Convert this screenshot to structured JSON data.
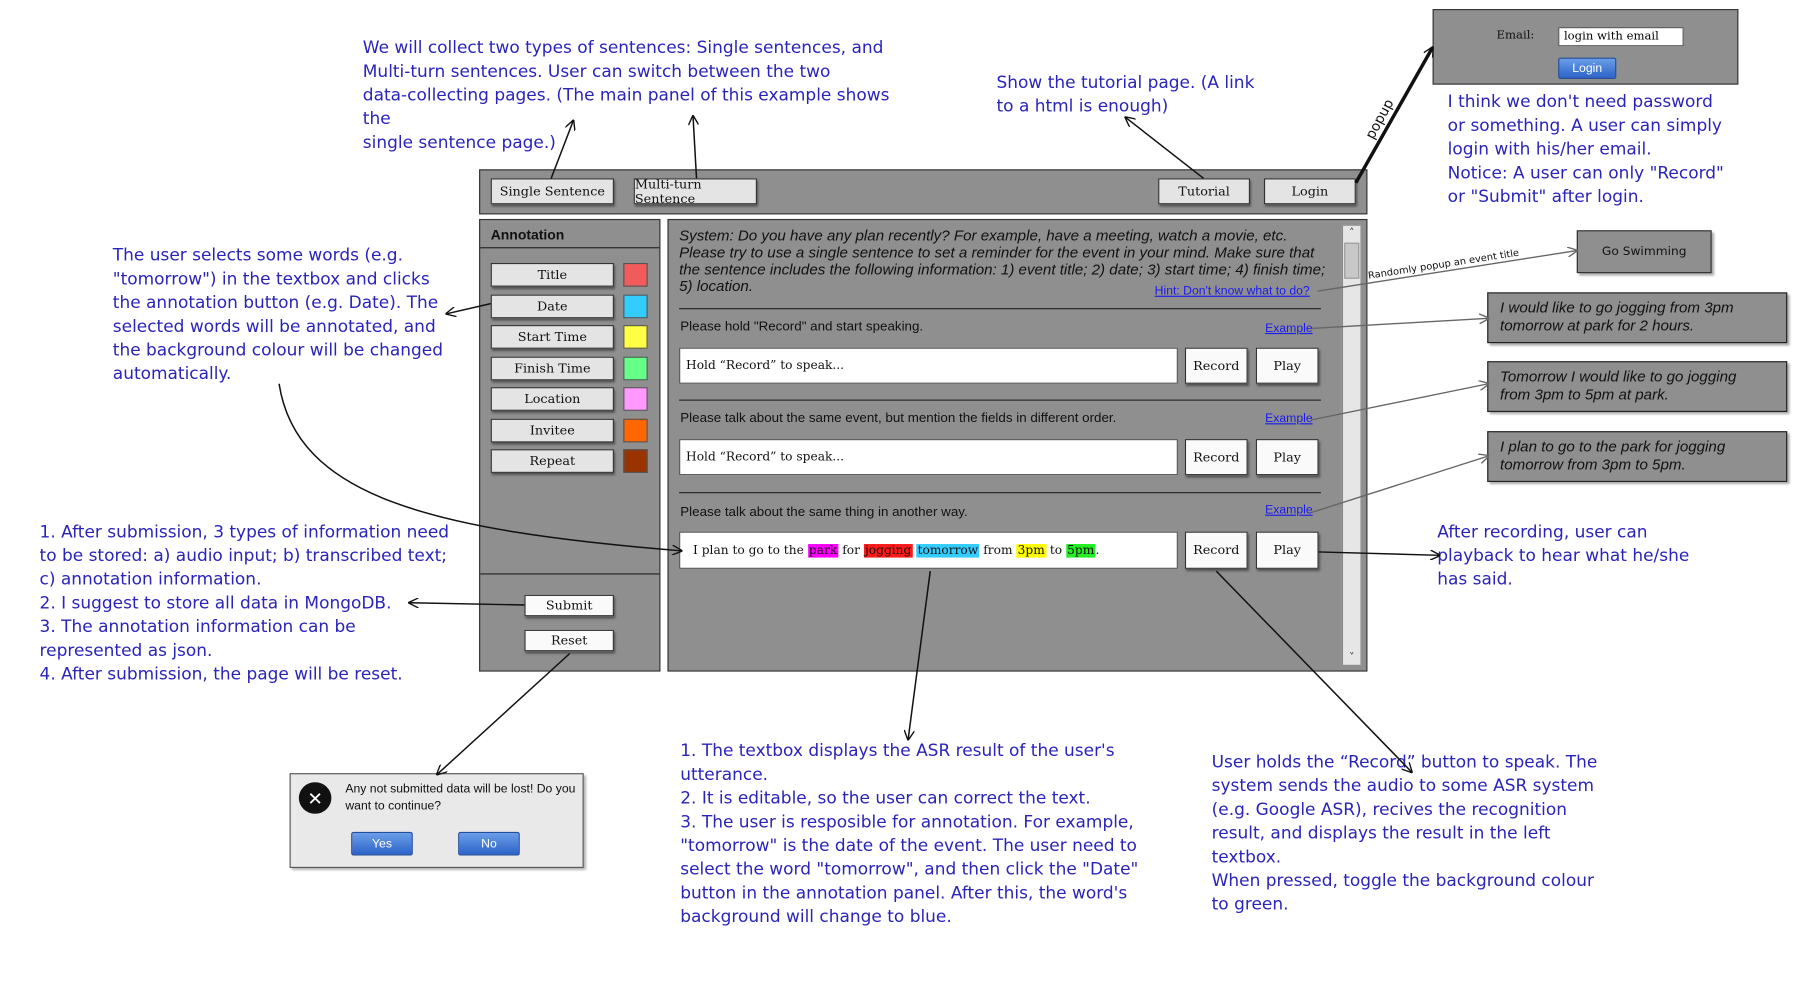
{
  "notes": {
    "top_left": "We will collect two types of sentences: Single sentences, and\nMulti-turn sentences. User can switch between the two\ndata-collecting pages. (The main panel of this example shows the\nsingle sentence page.)",
    "tutorial": "Show the tutorial page. (A link\nto a html is enough)",
    "login": "I think we don't need password\nor something. A user can simply\nlogin with his/her email.\nNotice: A user can only \"Record\"\nor \"Submit\" after login.",
    "annotation": "The user selects some words (e.g.\n\"tomorrow\") in the textbox and clicks\nthe annotation button (e.g. Date). The\nselected words will be annotated, and\nthe background colour will be changed\nautomatically.",
    "submission": "1. After submission, 3 types of information need\nto be stored: a) audio input; b) transcribed text;\nc) annotation information.\n2. I suggest to store all data in MongoDB.\n3. The annotation information can be\nrepresented as json.\n4. After submission, the page will be reset.",
    "playback": "After recording, user can\nplayback to hear what he/she\nhas said.",
    "textbox": "1. The textbox displays the ASR result of the user's\nutterance.\n2. It is editable, so the user can correct the text.\n3. The user is resposible for annotation. For example,\n\"tomorrow\" is the date of the event. The user need to\nselect the word \"tomorrow\", and then click the \"Date\"\nbutton in the annotation panel. After this, the word's\nbackground will change to blue.",
    "record": "User holds the “Record” button to speak. The\nsystem sends the audio to some ASR system\n(e.g. Google ASR), recives the recognition\nresult, and displays the result in the left\ntextbox.\nWhen pressed, toggle the background colour\nto green."
  },
  "topbar": {
    "single_sentence": "Single Sentence",
    "multi_turn": "Multi-turn Sentence",
    "tutorial": "Tutorial",
    "login": "Login"
  },
  "login_popup": {
    "email_label": "Email:",
    "email_value": "login with email",
    "button": "Login",
    "arrow_label": "popup"
  },
  "annotation": {
    "title": "Annotation",
    "items": [
      {
        "label": "Title",
        "color": "#f25b5b"
      },
      {
        "label": "Date",
        "color": "#33ccff"
      },
      {
        "label": "Start Time",
        "color": "#ffff44"
      },
      {
        "label": "Finish Time",
        "color": "#66ff88"
      },
      {
        "label": "Location",
        "color": "#ff99ff"
      },
      {
        "label": "Invitee",
        "color": "#ff6600"
      },
      {
        "label": "Repeat",
        "color": "#993300"
      }
    ],
    "submit": "Submit",
    "reset": "Reset"
  },
  "main": {
    "system_text": "System: Do you have any plan recently? For example, have a meeting, watch a movie, etc. Please try to use a single sentence to set a reminder for the event in your mind. Make sure that the sentence includes the following information: 1) event title; 2) date; 3) start time; 4) finish time; 5) location.",
    "hint_link": "Hint: Don't know what to do?",
    "example_link": "Example",
    "record": "Record",
    "play": "Play",
    "sections": [
      {
        "prompt": "Please hold \"Record\" and start speaking.",
        "placeholder": "Hold “Record” to speak..."
      },
      {
        "prompt": "Please talk about the same event, but mention the fields in different order.",
        "placeholder": "Hold “Record” to speak..."
      },
      {
        "prompt": "Please talk about the same thing in another way."
      }
    ],
    "annotated_sentence": [
      {
        "text": "I plan to go to the "
      },
      {
        "text": "park",
        "bg": "#ff00ff"
      },
      {
        "text": " for "
      },
      {
        "text": "jogging",
        "bg": "#ff1a1a"
      },
      {
        "text": " "
      },
      {
        "text": "tomorrow",
        "bg": "#33ccff"
      },
      {
        "text": " from "
      },
      {
        "text": "3pm",
        "bg": "#ffff00"
      },
      {
        "text": " to "
      },
      {
        "text": "5pm",
        "bg": "#22ee22"
      },
      {
        "text": "."
      }
    ]
  },
  "popups": {
    "event_title": "Go Swimming",
    "event_title_label": "Randomly popup an event title",
    "examples": [
      "I would like to go jogging from 3pm\ntomorrow at park for 2 hours.",
      "Tomorrow I would like to go jogging\nfrom 3pm to 5pm at park.",
      "I plan to go to the park for jogging\ntomorrow from 3pm to 5pm."
    ]
  },
  "dialog": {
    "message": "Any not submitted data will be lost! Do you want to continue?",
    "yes": "Yes",
    "no": "No"
  }
}
